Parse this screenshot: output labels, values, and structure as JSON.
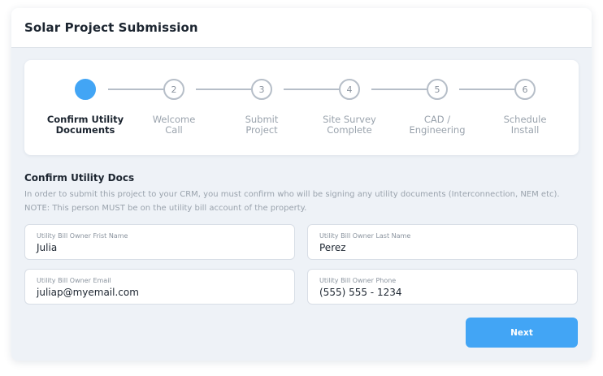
{
  "header": {
    "title": "Solar Project Submission"
  },
  "stepper": {
    "steps": [
      {
        "number": "",
        "label": "Confirm Utility\nDocuments",
        "active": true
      },
      {
        "number": "2",
        "label": "Welcome\nCall",
        "active": false
      },
      {
        "number": "3",
        "label": "Submit\nProject",
        "active": false
      },
      {
        "number": "4",
        "label": "Site Survey\nComplete",
        "active": false
      },
      {
        "number": "5",
        "label": "CAD /\nEngineering",
        "active": false
      },
      {
        "number": "6",
        "label": "Schedule\nInstall",
        "active": false
      }
    ]
  },
  "section": {
    "title": "Confirm Utility Docs",
    "description": "In order to submit this project to your CRM, you must confirm who will be signing any utility documents (Interconnection, NEM etc). NOTE: This person MUST be on the utility bill account of the property."
  },
  "fields": {
    "first_name": {
      "label": "Utility Bill Owner Frist Name",
      "value": "Julia"
    },
    "last_name": {
      "label": "Utility Bill Owner Last Name",
      "value": "Perez"
    },
    "email": {
      "label": "Utility Bill Owner Email",
      "value": "juliap@myemail.com"
    },
    "phone": {
      "label": "Utility Bill Owner Phone",
      "value": "(555) 555 - 1234"
    }
  },
  "actions": {
    "next_label": "Next"
  },
  "colors": {
    "accent": "#42a5f5",
    "background": "#eef2f7",
    "text": "#1c2530",
    "muted": "#9aa3ad"
  }
}
